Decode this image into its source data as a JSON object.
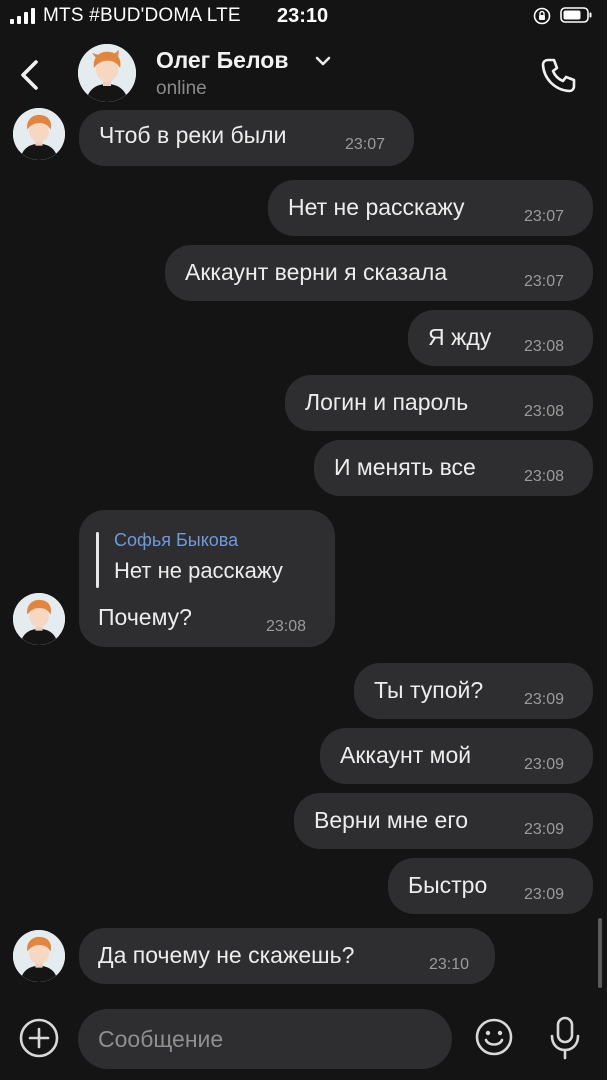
{
  "status_bar": {
    "carrier": "MTS #BUD'DOMA  LTE",
    "time": "23:10"
  },
  "header": {
    "name": "Олег Белов",
    "status": "online"
  },
  "messages": [
    {
      "text": "Чтоб в реки были",
      "time": "23:07"
    },
    {
      "text": "Нет не расскажу",
      "time": "23:07"
    },
    {
      "text": "Аккаунт верни я сказала",
      "time": "23:07"
    },
    {
      "text": "Я жду",
      "time": "23:08"
    },
    {
      "text": "Логин и пароль",
      "time": "23:08"
    },
    {
      "text": "И менять все",
      "time": "23:08"
    },
    {
      "reply_name": "Софья Быкова",
      "reply_text": "Нет не расскажу",
      "text": "Почему?",
      "time": "23:08"
    },
    {
      "text": "Ты тупой?",
      "time": "23:09"
    },
    {
      "text": "Аккаунт мой",
      "time": "23:09"
    },
    {
      "text": "Верни мне его",
      "time": "23:09"
    },
    {
      "text": "Быстро",
      "time": "23:09"
    },
    {
      "text": "Да почему не скажешь?",
      "time": "23:10"
    }
  ],
  "composer": {
    "placeholder": "Сообщение"
  },
  "colors": {
    "background": "#141414",
    "bubble": "#2e2e30",
    "reply_name": "#6e9bd6"
  },
  "icons": [
    "back-arrow-icon",
    "chevron-down-icon",
    "phone-icon",
    "plus-circle-icon",
    "emoji-icon",
    "microphone-icon"
  ]
}
